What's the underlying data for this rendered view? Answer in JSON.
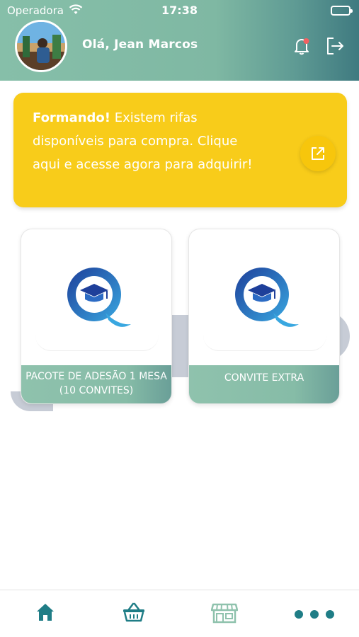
{
  "status_bar": {
    "carrier": "Operadora",
    "time": "17:38"
  },
  "header": {
    "greeting": "Olá, Jean Marcos"
  },
  "banner": {
    "bold_text": "Formando!",
    "text": " Existem rifas disponíveis para compra. Clique aqui e acesse agora para adquirir!"
  },
  "products": [
    {
      "label": "PACOTE DE ADESÃO 1 MESA (10 CONVITES)"
    },
    {
      "label": "CONVITE EXTRA"
    }
  ],
  "tabbar": {
    "items": [
      {
        "icon": "home-icon"
      },
      {
        "icon": "basket-icon"
      },
      {
        "icon": "store-icon"
      },
      {
        "icon": "more-icon"
      }
    ]
  },
  "colors": {
    "header_start": "#86bfa9",
    "header_end": "#3f7a80",
    "banner": "#f8cc1a",
    "tab_active": "#1f7d86",
    "tab_inactive": "#8fc2ad"
  }
}
